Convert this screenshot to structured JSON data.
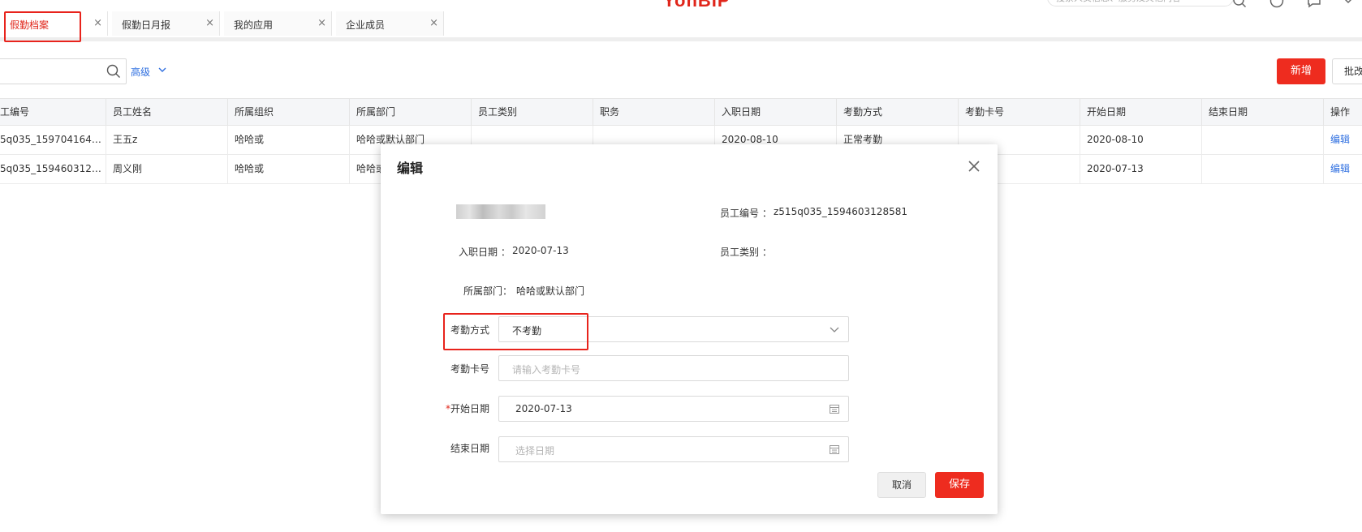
{
  "brand": {
    "logo_text": "YonBIP"
  },
  "header": {
    "search_placeholder": "搜索人员信息、服务及其他内容"
  },
  "tabs": [
    {
      "label": "假勤档案",
      "close": "×",
      "active": true
    },
    {
      "label": "假勤日月报",
      "close": "×",
      "active": false
    },
    {
      "label": "我的应用",
      "close": "×",
      "active": false
    },
    {
      "label": "企业成员",
      "close": "×",
      "active": false
    }
  ],
  "toolbar": {
    "search_value": "",
    "advanced_label": "高级",
    "new_label": "新增",
    "batch_label": "批改"
  },
  "table": {
    "columns": [
      "工编号",
      "员工姓名",
      "所属组织",
      "所属部门",
      "员工类别",
      "职务",
      "入职日期",
      "考勤方式",
      "考勤卡号",
      "开始日期",
      "结束日期",
      "操作"
    ],
    "rows": [
      [
        "5q035_1597041641...",
        "王五z",
        "哈哈或",
        "哈哈或默认部门",
        "",
        "",
        "2020-08-10",
        "正常考勤",
        "",
        "2020-08-10",
        "",
        "编辑"
      ],
      [
        "5q035_1594603128...",
        "周义刚",
        "哈哈或",
        "哈哈或",
        "",
        "",
        "",
        "",
        "",
        "2020-07-13",
        "",
        "编辑"
      ]
    ]
  },
  "modal": {
    "title": "编辑",
    "employee_no_label": "员工编号 ：",
    "employee_no_value": "z515q035_1594603128581",
    "hire_date_label": "入职日期 ：",
    "hire_date_value": "2020-07-13",
    "employee_type_label": "员工类别 ：",
    "employee_type_value": "",
    "dept_label": "所属部门：",
    "dept_value": "哈哈或默认部门",
    "attendance_mode_label": "考勤方式",
    "attendance_mode_value": "不考勤",
    "card_no_label": "考勤卡号",
    "card_no_placeholder": "请输入考勤卡号",
    "start_date_required": "*",
    "start_date_label": "开始日期",
    "start_date_value": "2020-07-13",
    "end_date_label": "结束日期",
    "end_date_placeholder": "选择日期",
    "cancel_label": "取消",
    "save_label": "保存"
  },
  "colors": {
    "accent_red": "#ee2c1f",
    "highlight_red": "#e8231c",
    "link_blue": "#2f6fe0"
  },
  "icons": {
    "search": "search-icon",
    "chevron_down": "chevron-down-icon",
    "close": "close-icon",
    "calendar": "calendar-icon"
  }
}
